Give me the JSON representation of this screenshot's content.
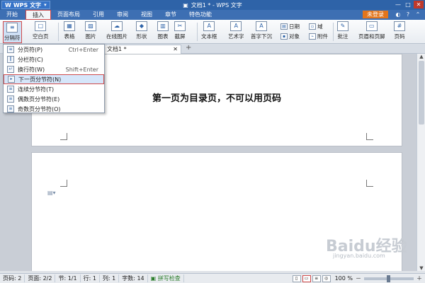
{
  "app": {
    "name": "WPS 文字",
    "window_title": "文档1 * - WPS 文字"
  },
  "tabs": [
    {
      "label": "开始"
    },
    {
      "label": "插入"
    },
    {
      "label": "页面布局"
    },
    {
      "label": "引用"
    },
    {
      "label": "审阅"
    },
    {
      "label": "视图"
    },
    {
      "label": "章节"
    },
    {
      "label": "特色功能"
    }
  ],
  "topright": {
    "login_label": "未登录"
  },
  "ribbon": {
    "break_label": "分隔符",
    "blank_page_label": "空白页",
    "table_label": "表格",
    "picture_label": "图片",
    "online_picture_label": "在线图片",
    "shape_label": "形状",
    "chart_label": "图表",
    "screenshot_label": "截屏",
    "textbox_label": "文本框",
    "wordart_label": "艺术字",
    "dropcap_label": "首字下沉",
    "date_label": "日期",
    "field_label": "域",
    "object_label": "对象",
    "attachment_label": "附件",
    "comment_label": "批注",
    "header_footer_label": "页眉和页脚",
    "page_number_label": "页码"
  },
  "doc_tab": {
    "title": "文档1 *"
  },
  "menu": {
    "items": [
      {
        "label": "分页符(P)",
        "shortcut": "Ctrl+Enter"
      },
      {
        "label": "分栏符(C)",
        "shortcut": ""
      },
      {
        "label": "换行符(W)",
        "shortcut": "Shift+Enter"
      },
      {
        "label": "下一页分节符(N)",
        "shortcut": ""
      },
      {
        "label": "连续分节符(T)",
        "shortcut": ""
      },
      {
        "label": "偶数页分节符(E)",
        "shortcut": ""
      },
      {
        "label": "奇数页分节符(O)",
        "shortcut": ""
      }
    ]
  },
  "document": {
    "page1_text": "第一页为目录页，不可以用页码"
  },
  "status": {
    "page": "页码: 2",
    "pages": "页面: 2/2",
    "section": "节: 1/1",
    "row": "行: 1",
    "col": "列: 1",
    "words": "字数: 14",
    "spell": "拼写检查",
    "zoom": "100 %"
  },
  "watermark": {
    "text": "Baidu经验",
    "sub": "jingyan.baidu.com"
  }
}
